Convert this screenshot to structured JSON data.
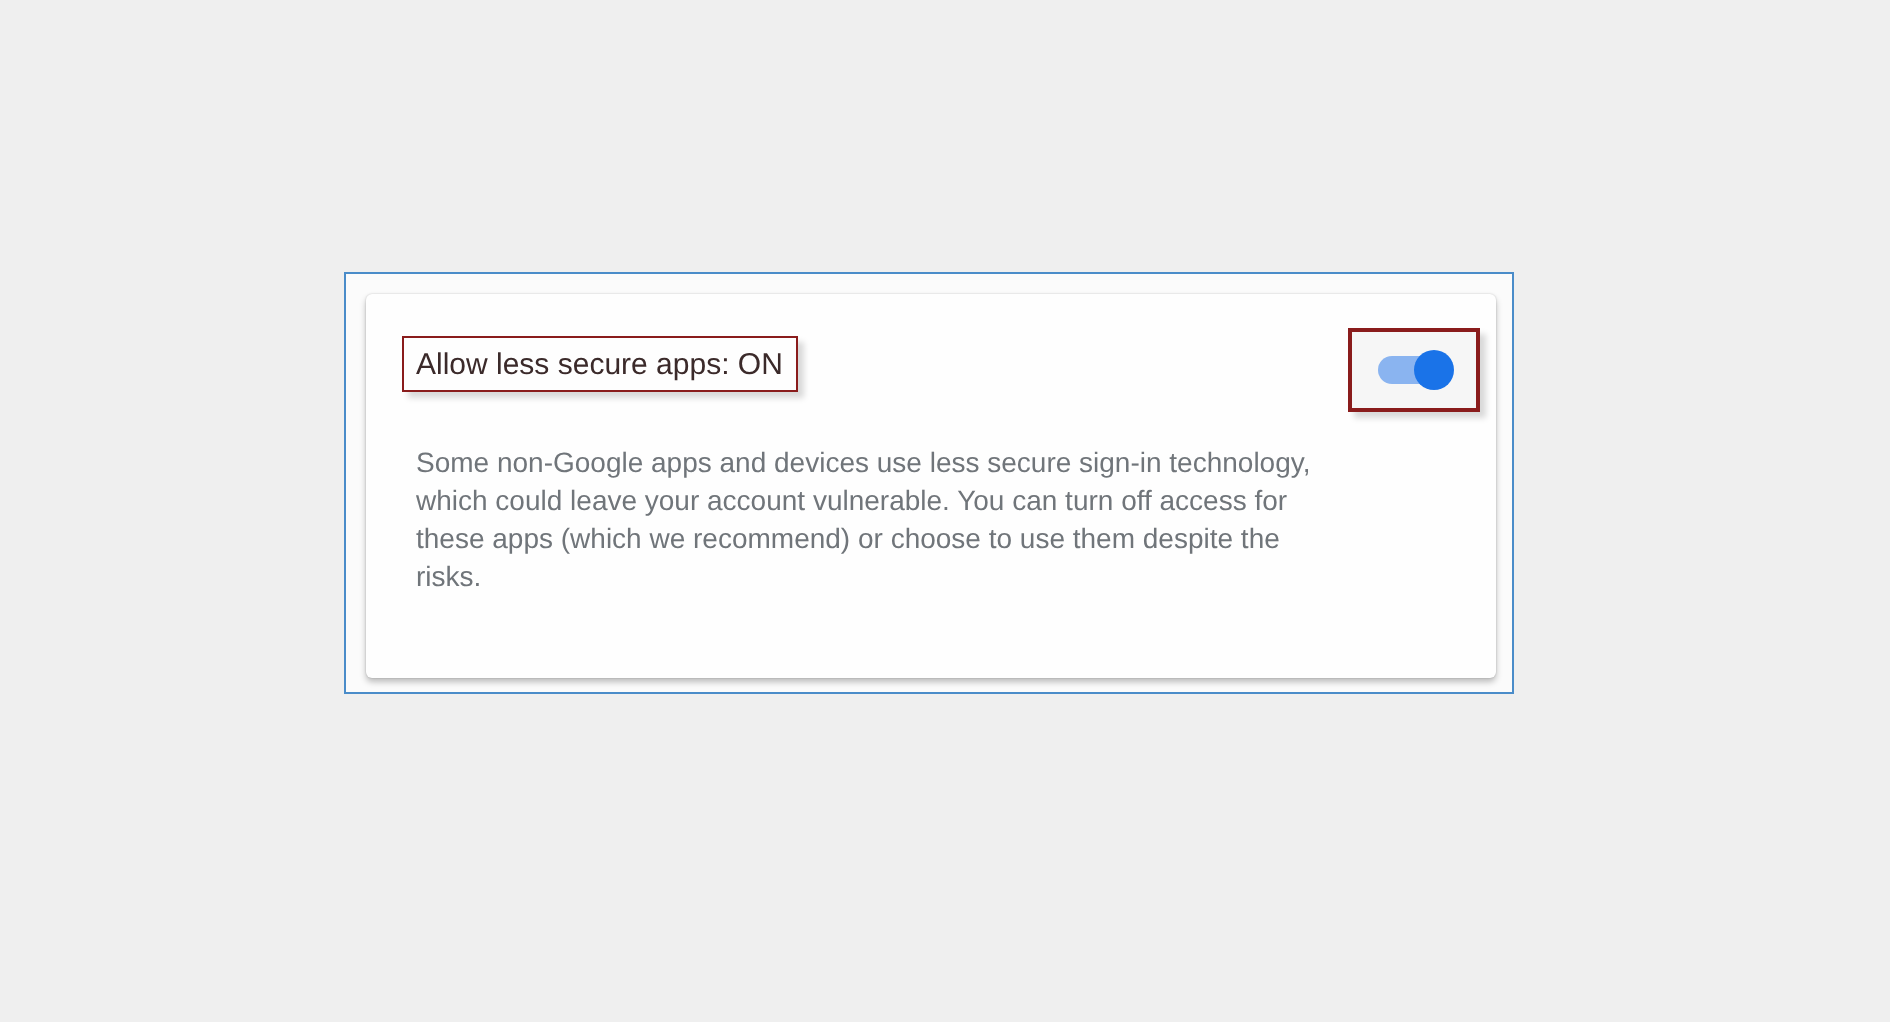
{
  "setting": {
    "title": "Allow less secure apps: ON",
    "on": true,
    "description": "Some non-Google apps and devices use less secure sign-in technology, which could leave your account vulnerable. You can turn off access for these apps (which we recommend) or choose to use them despite the risks."
  }
}
